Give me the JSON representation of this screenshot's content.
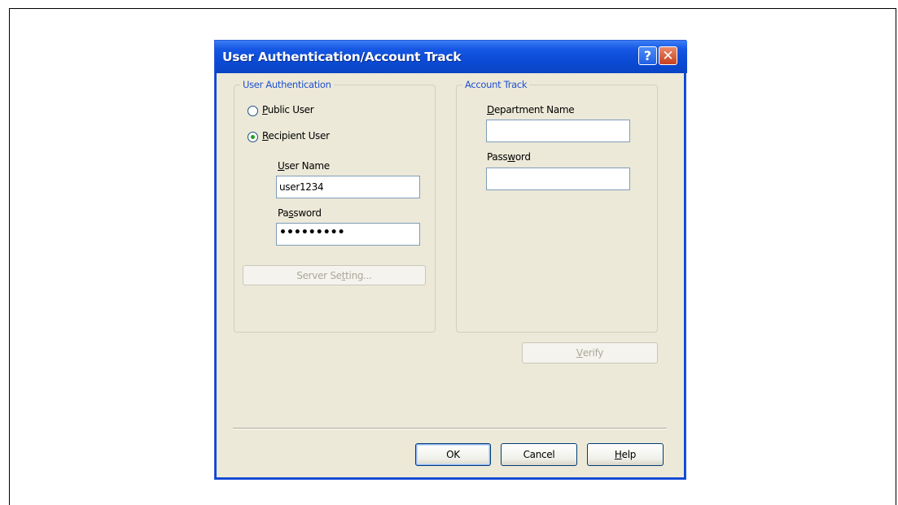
{
  "dialog": {
    "title": "User Authentication/Account Track",
    "help_glyph": "?",
    "close_glyph": "✕"
  },
  "user_auth": {
    "group_title": "User Authentication",
    "public_user": {
      "mnemonic": "P",
      "rest": "ublic User",
      "selected": false
    },
    "recipient_user": {
      "mnemonic": "R",
      "rest": "ecipient User",
      "selected": true
    },
    "user_name": {
      "mnemonic": "U",
      "rest": "ser Name",
      "value": "user1234"
    },
    "password": {
      "pre": "Pa",
      "mnemonic": "s",
      "rest": "sword",
      "value": "•••••••••"
    },
    "server_setting_button": {
      "pre": "Server Se",
      "mnemonic": "t",
      "rest": "ting...",
      "enabled": false
    }
  },
  "account_track": {
    "group_title": "Account Track",
    "department_name": {
      "mnemonic": "D",
      "rest": "epartment Name",
      "value": ""
    },
    "password": {
      "pre": "Pass",
      "mnemonic": "w",
      "rest": "ord",
      "value": ""
    }
  },
  "verify_button": {
    "mnemonic": "V",
    "rest": "erify",
    "enabled": false
  },
  "footer": {
    "ok_label": "OK",
    "cancel_label": "Cancel",
    "help": {
      "mnemonic": "H",
      "rest": "elp"
    }
  },
  "colors": {
    "titlebar": "#0b4bd6",
    "dialog_bg": "#ece9d8",
    "group_title": "#1f4fd0",
    "radio_dot": "#21a121"
  }
}
